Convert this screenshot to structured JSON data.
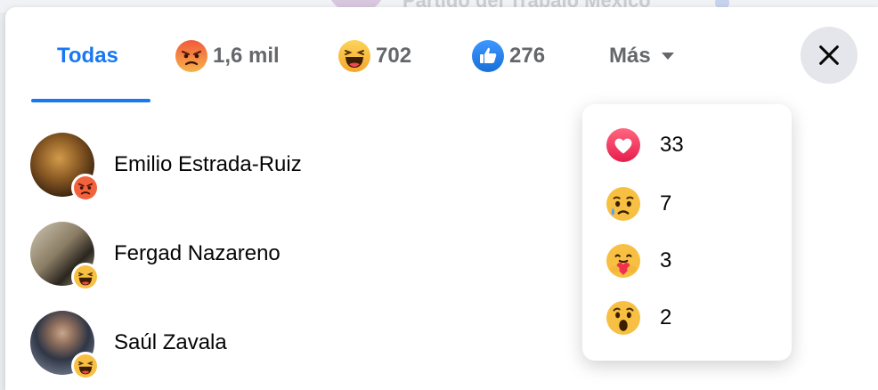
{
  "background": {
    "page_name": "Partido del Trabajo México"
  },
  "tabs": [
    {
      "label": "Todas"
    },
    {
      "label": "1,6 mil",
      "icon": "angry-emoji-icon"
    },
    {
      "label": "702",
      "icon": "haha-emoji-icon"
    },
    {
      "label": "276",
      "icon": "like-icon"
    },
    {
      "label": "Más",
      "icon": "caret-down-icon"
    }
  ],
  "people": [
    {
      "name": "Emilio Estrada-Ruiz",
      "reaction": "angry-emoji-icon"
    },
    {
      "name": "Fergad Nazareno",
      "reaction": "haha-emoji-icon"
    },
    {
      "name": "Saúl Zavala",
      "reaction": "haha-emoji-icon"
    }
  ],
  "more_menu": [
    {
      "count": "33",
      "icon": "love-heart-icon"
    },
    {
      "count": "7",
      "icon": "sad-emoji-icon"
    },
    {
      "count": "3",
      "icon": "care-emoji-icon"
    },
    {
      "count": "2",
      "icon": "wow-emoji-icon"
    }
  ],
  "colors": {
    "accent": "#1877f2",
    "text": "#050505",
    "muted": "#65676b"
  }
}
